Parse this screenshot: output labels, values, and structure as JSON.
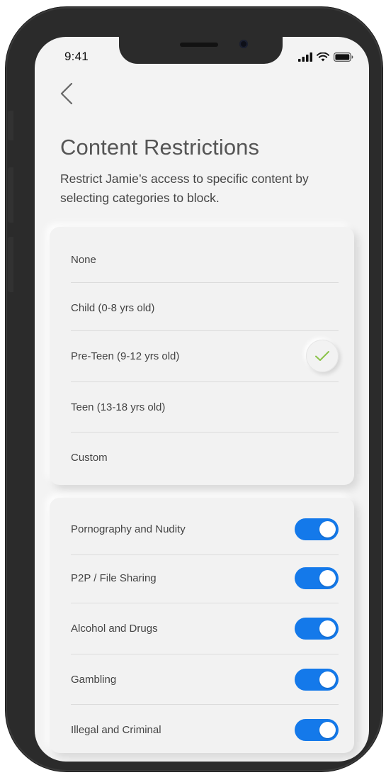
{
  "status_bar": {
    "time": "9:41"
  },
  "icons": {
    "back": "chevron-left-icon",
    "signal": "cellular-signal-icon",
    "wifi": "wifi-icon",
    "battery": "battery-icon",
    "check": "checkmark-icon"
  },
  "header": {
    "title": "Content Restrictions",
    "description": "Restrict Jamie’s access to specific content by selecting categories to block."
  },
  "levels": {
    "items": [
      {
        "label": "None",
        "selected": false
      },
      {
        "label": "Child (0-8 yrs old)",
        "selected": false
      },
      {
        "label": "Pre-Teen (9-12 yrs old)",
        "selected": true
      },
      {
        "label": "Teen (13-18 yrs old)",
        "selected": false
      },
      {
        "label": "Custom",
        "selected": false
      }
    ]
  },
  "categories": {
    "items": [
      {
        "label": "Pornography and Nudity",
        "enabled": true
      },
      {
        "label": "P2P / File Sharing",
        "enabled": true
      },
      {
        "label": "Alcohol and Drugs",
        "enabled": true
      },
      {
        "label": "Gambling",
        "enabled": true
      },
      {
        "label": "Illegal and Criminal",
        "enabled": true
      }
    ]
  },
  "colors": {
    "toggle_on": "#1479ea",
    "check": "#8bc34a",
    "background": "#f3f3f3"
  }
}
